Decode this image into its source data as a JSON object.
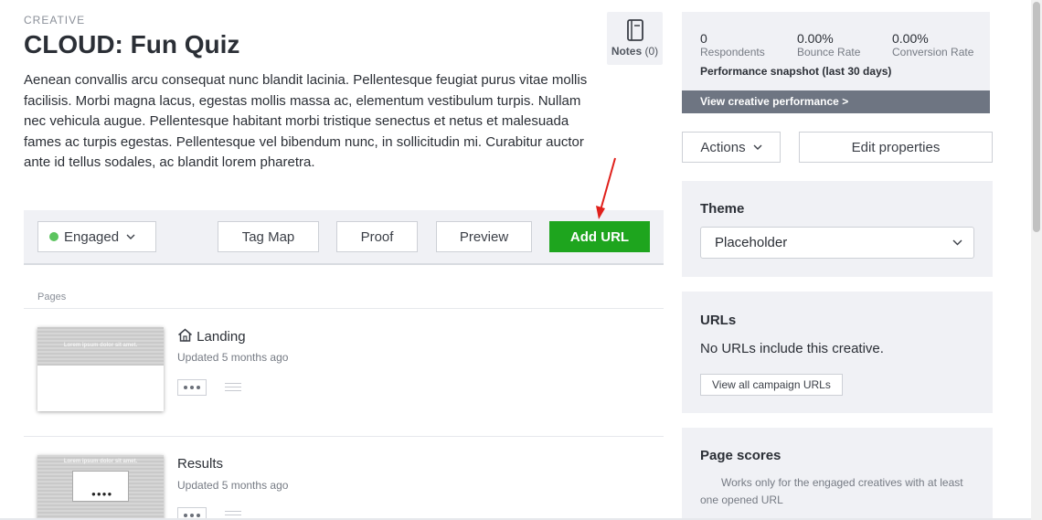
{
  "header": {
    "eyebrow": "CREATIVE",
    "title": "CLOUD: Fun Quiz",
    "description": "Aenean convallis arcu consequat nunc blandit lacinia. Pellentesque feugiat purus vitae mollis facilisis. Morbi magna lacus, egestas mollis massa ac, elementum vestibulum turpis. Nullam nec vehicula augue. Pellentesque habitant morbi tristique senectus et netus et malesuada fames ac turpis egestas. Pellentesque vel bibendum nunc, in sollicitudin mi. Curabitur auctor ante id tellus sodales, ac blandit lorem pharetra."
  },
  "notes": {
    "label": "Notes",
    "count": "(0)"
  },
  "toolbar": {
    "status_label": "Engaged",
    "status_color": "#5cc45f",
    "tag_map": "Tag Map",
    "proof": "Proof",
    "preview": "Preview",
    "add_url": "Add URL"
  },
  "pages": {
    "label": "Pages",
    "items": [
      {
        "name": "Landing",
        "updated": "Updated 5 months ago",
        "thumb_text": "Lorem ipsum dolor sit amet.",
        "icon": "home-icon"
      },
      {
        "name": "Results",
        "updated": "Updated 5 months ago",
        "thumb_text": "Lorem ipsum dolor sit amet."
      }
    ]
  },
  "performance": {
    "stats": [
      {
        "value": "0",
        "label": "Respondents"
      },
      {
        "value": "0.00%",
        "label": "Bounce Rate"
      },
      {
        "value": "0.00%",
        "label": "Conversion Rate"
      }
    ],
    "snapshot": "Performance snapshot (last 30 days)",
    "link": "View creative performance >"
  },
  "actions": {
    "actions_label": "Actions",
    "edit_label": "Edit properties"
  },
  "theme": {
    "title": "Theme",
    "selected": "Placeholder"
  },
  "urls": {
    "title": "URLs",
    "text": "No URLs include this creative.",
    "button": "View all campaign URLs"
  },
  "scores": {
    "title": "Page scores",
    "text": "Works only for the engaged creatives with at least one opened URL"
  },
  "colors": {
    "accent_green": "#1ea51e",
    "panel_bg": "#f0f1f5",
    "link_bar": "#6e7582",
    "annotation_arrow": "#e0201b"
  }
}
